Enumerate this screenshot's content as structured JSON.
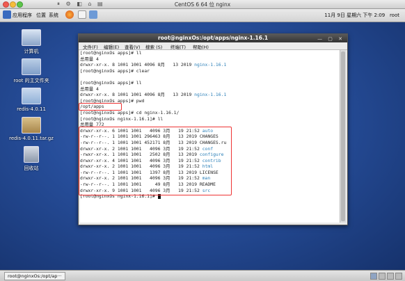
{
  "vm_window": {
    "title": "CentOS 6 64 位 nginx"
  },
  "gnome_panel": {
    "menus": [
      "应用程序",
      "位置",
      "系统"
    ],
    "clock": "11月 9日 星期六  下午 2:09",
    "user": "root"
  },
  "desktop_icons": [
    {
      "label": "计算机",
      "icon": "computer-icon"
    },
    {
      "label": "root 的主文件夹",
      "icon": "home-folder-icon"
    },
    {
      "label": "redis-4.0.11",
      "icon": "folder-icon"
    },
    {
      "label": "redis-4.0.11.tar.gz",
      "icon": "archive-icon"
    },
    {
      "label": "回收站",
      "icon": "trash-icon"
    }
  ],
  "terminal": {
    "title": "root@nginxOs:/opt/apps/nginx-1.16.1",
    "menu": [
      "文件(F)",
      "编辑(E)",
      "查看(V)",
      "搜索 (S)",
      "终端(T)",
      "帮助(H)"
    ],
    "lines": [
      {
        "text": "[root@nginxOs apps]# ll"
      },
      {
        "text": "总用量 4"
      },
      {
        "text": "drwxr-xr-x. 8 1001 1001 4096 8月   13 2019 ",
        "blue": "nginx-1.16.1"
      },
      {
        "text": "[root@nginxOs apps]# clear"
      },
      {
        "text": ""
      },
      {
        "text": "[root@nginxOs apps]# ll"
      },
      {
        "text": "总用量 4"
      },
      {
        "text": "drwxr-xr-x. 8 1001 1001 4096 8月   13 2019 ",
        "blue": "nginx-1.16.1"
      },
      {
        "text": "[root@nginxOs apps]# pwd"
      },
      {
        "text": "/opt/apps"
      },
      {
        "text": "[root@nginxOs apps]# cd nginx-1.16.1/"
      },
      {
        "text": "[root@nginxOs nginx-1.16.1]# ll"
      },
      {
        "text": "总用量 772"
      },
      {
        "text": "drwxr-xr-x. 6 1001 1001   4096 3月   19 21:52 ",
        "blue": "auto"
      },
      {
        "text": "-rw-r--r--. 1 1001 1001 296463 8月   13 2019 CHANGES"
      },
      {
        "text": "-rw-r--r--. 1 1001 1001 452171 8月   13 2019 CHANGES.ru"
      },
      {
        "text": "drwxr-xr-x. 2 1001 1001   4096 3月   19 21:52 ",
        "blue": "conf"
      },
      {
        "text": "-rwxr-xr-x. 1 1001 1001   2502 8月   13 2019 ",
        "blue": "configure"
      },
      {
        "text": "drwxr-xr-x. 4 1001 1001   4096 3月   19 21:52 ",
        "blue": "contrib"
      },
      {
        "text": "drwxr-xr-x. 2 1001 1001   4096 3月   19 21:52 ",
        "blue": "html"
      },
      {
        "text": "-rw-r--r--. 1 1001 1001   1397 8月   13 2019 LICENSE"
      },
      {
        "text": "drwxr-xr-x. 2 1001 1001   4096 3月   19 21:52 ",
        "blue": "man"
      },
      {
        "text": "-rw-r--r--. 1 1001 1001     49 8月   13 2019 README"
      },
      {
        "text": "drwxr-xr-x. 9 1001 1001   4096 3月   19 21:52 ",
        "blue": "src"
      },
      {
        "text": "[root@nginxOs nginx-1.16.1]# ",
        "cursor": true
      }
    ]
  },
  "taskbar": {
    "task_label": "root@nginxOs:/opt/ap···"
  },
  "colors": {
    "highlight_box": "#e33333",
    "directory_blue": "#2a7fb8",
    "desktop_blue": "#264d99"
  }
}
